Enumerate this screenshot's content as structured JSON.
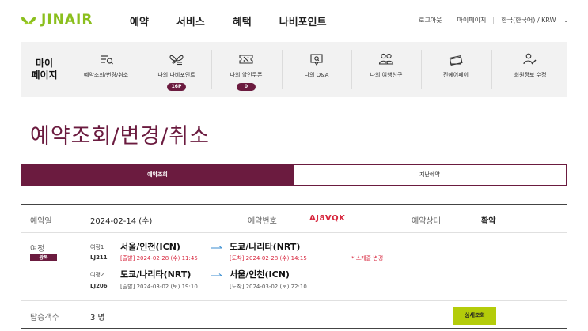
{
  "header": {
    "logo_text": "JINAIR",
    "nav": [
      "예약",
      "서비스",
      "혜택",
      "나비포인트"
    ],
    "util": {
      "logout": "로그아웃",
      "mypage": "마이페이지",
      "language": "한국(한국어) / KRW"
    }
  },
  "mypage_bar": {
    "title_line1": "마이",
    "title_line2": "페이지",
    "items": [
      {
        "label": "예약조회/변경/취소",
        "icon": "ticket-search-icon"
      },
      {
        "label": "나의 나비포인트",
        "icon": "butterfly-icon",
        "badge": "16P"
      },
      {
        "label": "나의 할인쿠폰",
        "icon": "coupon-icon",
        "badge": "0"
      },
      {
        "label": "나의 Q&A",
        "icon": "chat-question-icon"
      },
      {
        "label": "나의 여행친구",
        "icon": "friends-icon"
      },
      {
        "label": "진에어페이",
        "icon": "card-pay-icon"
      },
      {
        "label": "회원정보 수정",
        "icon": "user-edit-icon"
      }
    ]
  },
  "page": {
    "title": "예약조회/변경/취소"
  },
  "tabs": [
    {
      "label": "예약조회",
      "active": true
    },
    {
      "label": "지난예약",
      "active": false
    }
  ],
  "booking": {
    "date_label": "예약일",
    "date_value": "2024-02-14 (수)",
    "pnr_label": "예약번호",
    "pnr_value": "AJ8VQK",
    "status_label": "예약상태",
    "status_value": "확약",
    "itinerary_label": "여정",
    "trip_type": "왕복",
    "segments": [
      {
        "seg_label": "여정1",
        "flight": "LJ211",
        "from": "서울/인천(ICN)",
        "to": "도쿄/나리타(NRT)",
        "departure": "[출발] 2024-02-28 (수) 11:45",
        "arrival": "[도착] 2024-02-28 (수) 14:15",
        "notice": "* 스케줄 변경"
      },
      {
        "seg_label": "여정2",
        "flight": "LJ206",
        "from": "도쿄/나리타(NRT)",
        "to": "서울/인천(ICN)",
        "departure": "[출발] 2024-03-02 (토) 19:10",
        "arrival": "[도착] 2024-03-02 (토) 22:10"
      }
    ],
    "pax_label": "탑승객수",
    "pax_value": "3 명",
    "detail_button": "상세조회"
  },
  "colors": {
    "brand": "#6b1b3f",
    "accent_green": "#b4cc0a",
    "logo_green": "#8bbf1e",
    "alert_red": "#d7263d"
  }
}
